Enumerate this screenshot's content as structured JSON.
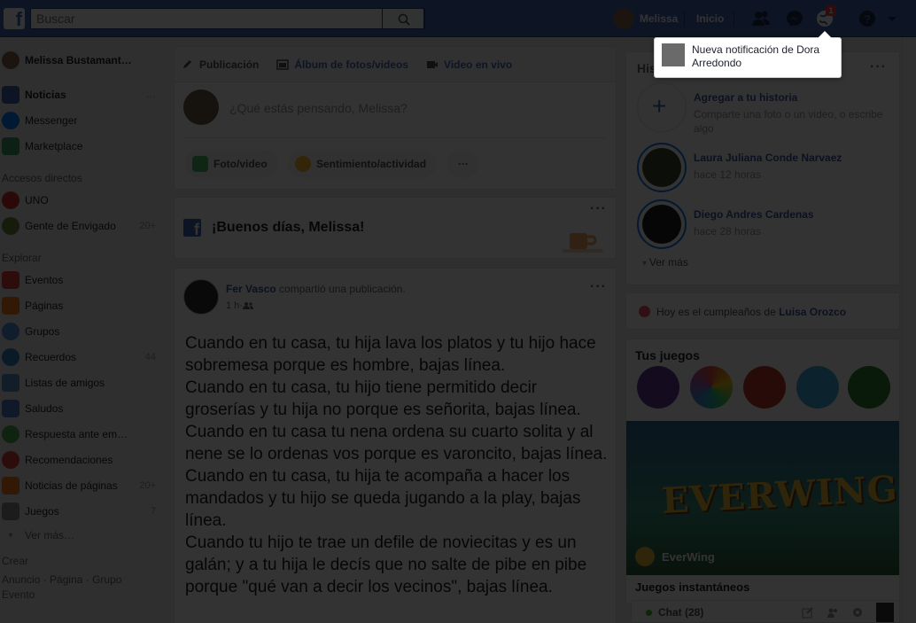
{
  "colors": {
    "brand": "#4267b2",
    "link": "#385898",
    "notification": "#fa3e3e",
    "online": "#42b72a"
  },
  "topbar": {
    "logo_letter": "f",
    "search_placeholder": "Buscar",
    "user_name": "Melissa",
    "home_label": "Inicio",
    "notification_count": "1"
  },
  "notification_popup": {
    "text": "Nueva notificación de Dora Arredondo"
  },
  "sidebar": {
    "profile_name": "Melissa Bustamant…",
    "items": [
      {
        "label": "Noticias",
        "icon": "news-feed-icon",
        "extra": "…"
      },
      {
        "label": "Messenger",
        "icon": "messenger-icon"
      },
      {
        "label": "Marketplace",
        "icon": "marketplace-icon"
      }
    ],
    "shortcuts_heading": "Accesos directos",
    "shortcuts": [
      {
        "label": "UNO",
        "icon": "uno-game-icon",
        "count": ""
      },
      {
        "label": "Gente de Envigado",
        "icon": "group-icon",
        "count": "20+"
      }
    ],
    "explore_heading": "Explorar",
    "explore": [
      {
        "label": "Eventos",
        "icon": "calendar-icon",
        "count": ""
      },
      {
        "label": "Páginas",
        "icon": "flag-icon",
        "count": ""
      },
      {
        "label": "Grupos",
        "icon": "groups-icon",
        "count": ""
      },
      {
        "label": "Recuerdos",
        "icon": "memories-icon",
        "count": "44"
      },
      {
        "label": "Listas de amigos",
        "icon": "friends-list-icon",
        "count": ""
      },
      {
        "label": "Saludos",
        "icon": "pokes-icon",
        "count": ""
      },
      {
        "label": "Respuesta ante em…",
        "icon": "crisis-response-icon",
        "count": ""
      },
      {
        "label": "Recomendaciones",
        "icon": "recommendations-icon",
        "count": ""
      },
      {
        "label": "Noticias de páginas",
        "icon": "pages-feed-icon",
        "count": "20+"
      },
      {
        "label": "Juegos",
        "icon": "games-icon",
        "count": "7"
      }
    ],
    "see_more": "Ver más…",
    "create_heading": "Crear",
    "create_links": [
      "Anuncio",
      "Página",
      "Grupo",
      "Evento"
    ],
    "create_sep": " · "
  },
  "composer": {
    "tabs": [
      {
        "label": "Publicación",
        "icon": "pencil-icon"
      },
      {
        "label": "Álbum de fotos/videos",
        "icon": "photo-album-icon"
      },
      {
        "label": "Video en vivo",
        "icon": "live-video-icon"
      }
    ],
    "placeholder": "¿Qué estás pensando, Melissa?",
    "photo_video": "Foto/video",
    "feeling": "Sentimiento/actividad",
    "more": "···"
  },
  "greeting": {
    "text": "¡Buenos días, Melissa!",
    "menu": "···"
  },
  "post": {
    "author": "Fer Vasco",
    "action": " compartió una publicación.",
    "time": "1 h",
    "audience_sep": " · ",
    "menu": "···",
    "body": [
      "Cuando en tu casa, tu hija lava los platos y tu hijo hace sobremesa porque es hombre, bajas línea.",
      "Cuando en tu casa, tu hijo tiene permitido decir groserías y tu hija no porque es señorita, bajas línea.",
      "Cuando en tu casa tu nena ordena su cuarto solita y al nene se lo ordenas vos porque es varoncito, bajas línea.",
      "Cuando en tu casa, tu hija te acompaña a hacer los mandados y tu hijo se queda jugando a la play, bajas línea.",
      "Cuando tu hijo te trae un defile de noviecitas y es un galán; y a tu hija le decís que no salte de pibe en pibe porque \"qué van a decir los vecinos\", bajas línea."
    ]
  },
  "stories": {
    "heading": "Historias",
    "menu": "···",
    "add_title": "Agregar a tu historia",
    "add_sub": "Comparte una foto o un video, o escribe algo",
    "items": [
      {
        "name": "Laura Juliana Conde Narvaez",
        "time": "hace 12 horas"
      },
      {
        "name": "Diego Andres Cardenas",
        "time": "hace 28 horas"
      }
    ],
    "see_more": "Ver más"
  },
  "birthday": {
    "prefix": "Hoy es el cumpleaños de ",
    "name": "Luisa Orozco"
  },
  "games": {
    "heading": "Tus juegos",
    "icons": [
      "pirate-game-icon",
      "smiley-game-icon",
      "candy-game-icon",
      "bubble-game-icon",
      "uno-game-icon"
    ],
    "featured_title": "EVERWING",
    "featured_name": "EverWing",
    "instant_heading": "Juegos instantáneos"
  },
  "chat": {
    "label": "Chat (28)"
  }
}
